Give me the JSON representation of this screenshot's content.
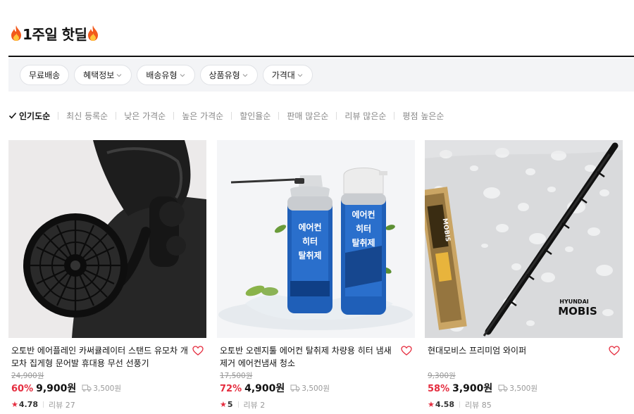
{
  "page": {
    "title": "1주일 핫딜"
  },
  "filters": [
    "무료배송",
    "혜택정보",
    "배송유형",
    "상품유형",
    "가격대"
  ],
  "filter_has_dropdown": [
    false,
    true,
    true,
    true,
    true
  ],
  "sort": {
    "active": "인기도순",
    "options": [
      "최신 등록순",
      "낮은 가격순",
      "높은 가격순",
      "할인율순",
      "판매 많은순",
      "리뷰 많은순",
      "평점 높은순"
    ]
  },
  "colors": {
    "discount": "#e52d3f",
    "filter_bg": "#f3f4f6",
    "rule": "#111111"
  },
  "products": [
    {
      "name": "오토반 에어플레인 카써큘레이터 스탠드 유모차 개모차 집게형 문어발 휴대용 무선 선풍기",
      "original_price": "24,900원",
      "discount": "60%",
      "price": "9,900원",
      "shipping": "3,500원",
      "rating": "4.78",
      "reviews": "리뷰 27",
      "image_icon": "clip-fan-image"
    },
    {
      "name": "오토반 오렌지툴 에어컨 탈취제 차량용 히터 냄새제거 에어컨냄새 청소",
      "original_price": "17,500원",
      "discount": "72%",
      "price": "4,900원",
      "shipping": "3,500원",
      "rating": "5",
      "reviews": "리뷰 2",
      "image_icon": "spray-can-image",
      "can_label": [
        "에어컨",
        "히터",
        "탈취제"
      ]
    },
    {
      "name": "현대모비스 프리미엄 와이퍼",
      "original_price": "9,300원",
      "discount": "58%",
      "price": "3,900원",
      "shipping": "3,500원",
      "rating": "4.58",
      "reviews": "리뷰 85",
      "image_icon": "wiper-image",
      "brand_top": "HYUNDAI",
      "brand_bottom": "MOBIS",
      "package_brand": "MOBIS"
    }
  ]
}
